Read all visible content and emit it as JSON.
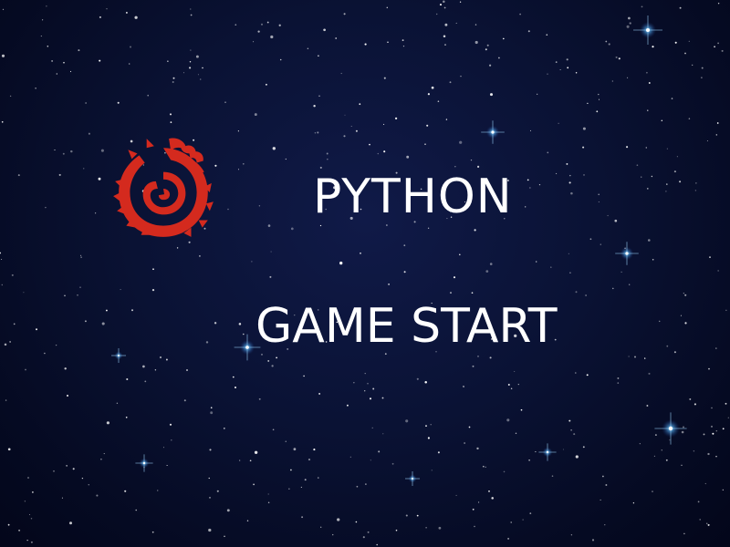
{
  "game": {
    "title": "PYTHON",
    "start_label": "GAME START"
  },
  "logo": {
    "icon": "red-dragon-g-emblem",
    "color": "#d42a1e"
  },
  "colors": {
    "text": "#ffffff",
    "background": "#0a1234",
    "star": "#ffffff",
    "star_glow": "#66ccff"
  }
}
